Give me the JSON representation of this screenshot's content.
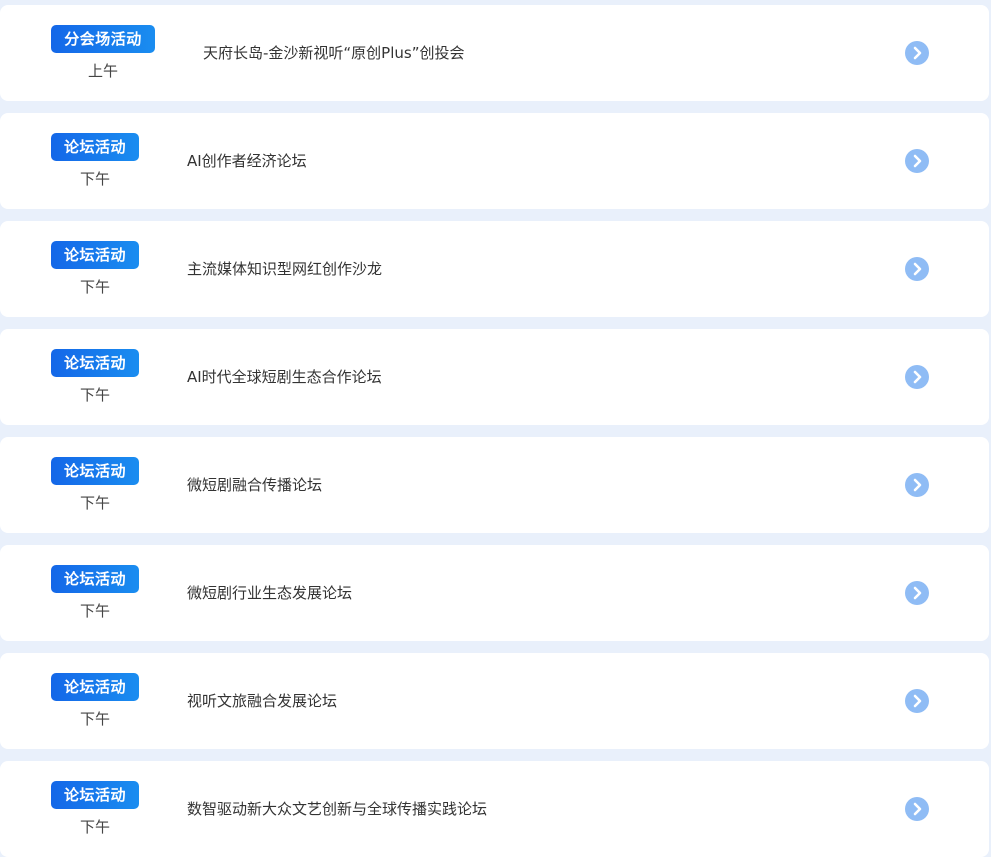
{
  "colors": {
    "page_background": "#e9f0fb",
    "card_background": "#ffffff",
    "badge_gradient_start": "#1467e8",
    "badge_gradient_end": "#1a8df0",
    "arrow_circle": "#8fbcf5",
    "title_text": "#333333"
  },
  "events": [
    {
      "badge": "分会场活动",
      "time": "上午",
      "title": "天府长岛-金沙新视听“原创Plus”创投会",
      "icon": "chevron-right-circle-icon"
    },
    {
      "badge": "论坛活动",
      "time": "下午",
      "title": "AI创作者经济论坛",
      "icon": "chevron-right-circle-icon"
    },
    {
      "badge": "论坛活动",
      "time": "下午",
      "title": "主流媒体知识型网红创作沙龙",
      "icon": "chevron-right-circle-icon"
    },
    {
      "badge": "论坛活动",
      "time": "下午",
      "title": "AI时代全球短剧生态合作论坛",
      "icon": "chevron-right-circle-icon"
    },
    {
      "badge": "论坛活动",
      "time": "下午",
      "title": "微短剧融合传播论坛",
      "icon": "chevron-right-circle-icon"
    },
    {
      "badge": "论坛活动",
      "time": "下午",
      "title": "微短剧行业生态发展论坛",
      "icon": "chevron-right-circle-icon"
    },
    {
      "badge": "论坛活动",
      "time": "下午",
      "title": "视听文旅融合发展论坛",
      "icon": "chevron-right-circle-icon"
    },
    {
      "badge": "论坛活动",
      "time": "下午",
      "title": "数智驱动新大众文艺创新与全球传播实践论坛",
      "icon": "chevron-right-circle-icon"
    }
  ]
}
